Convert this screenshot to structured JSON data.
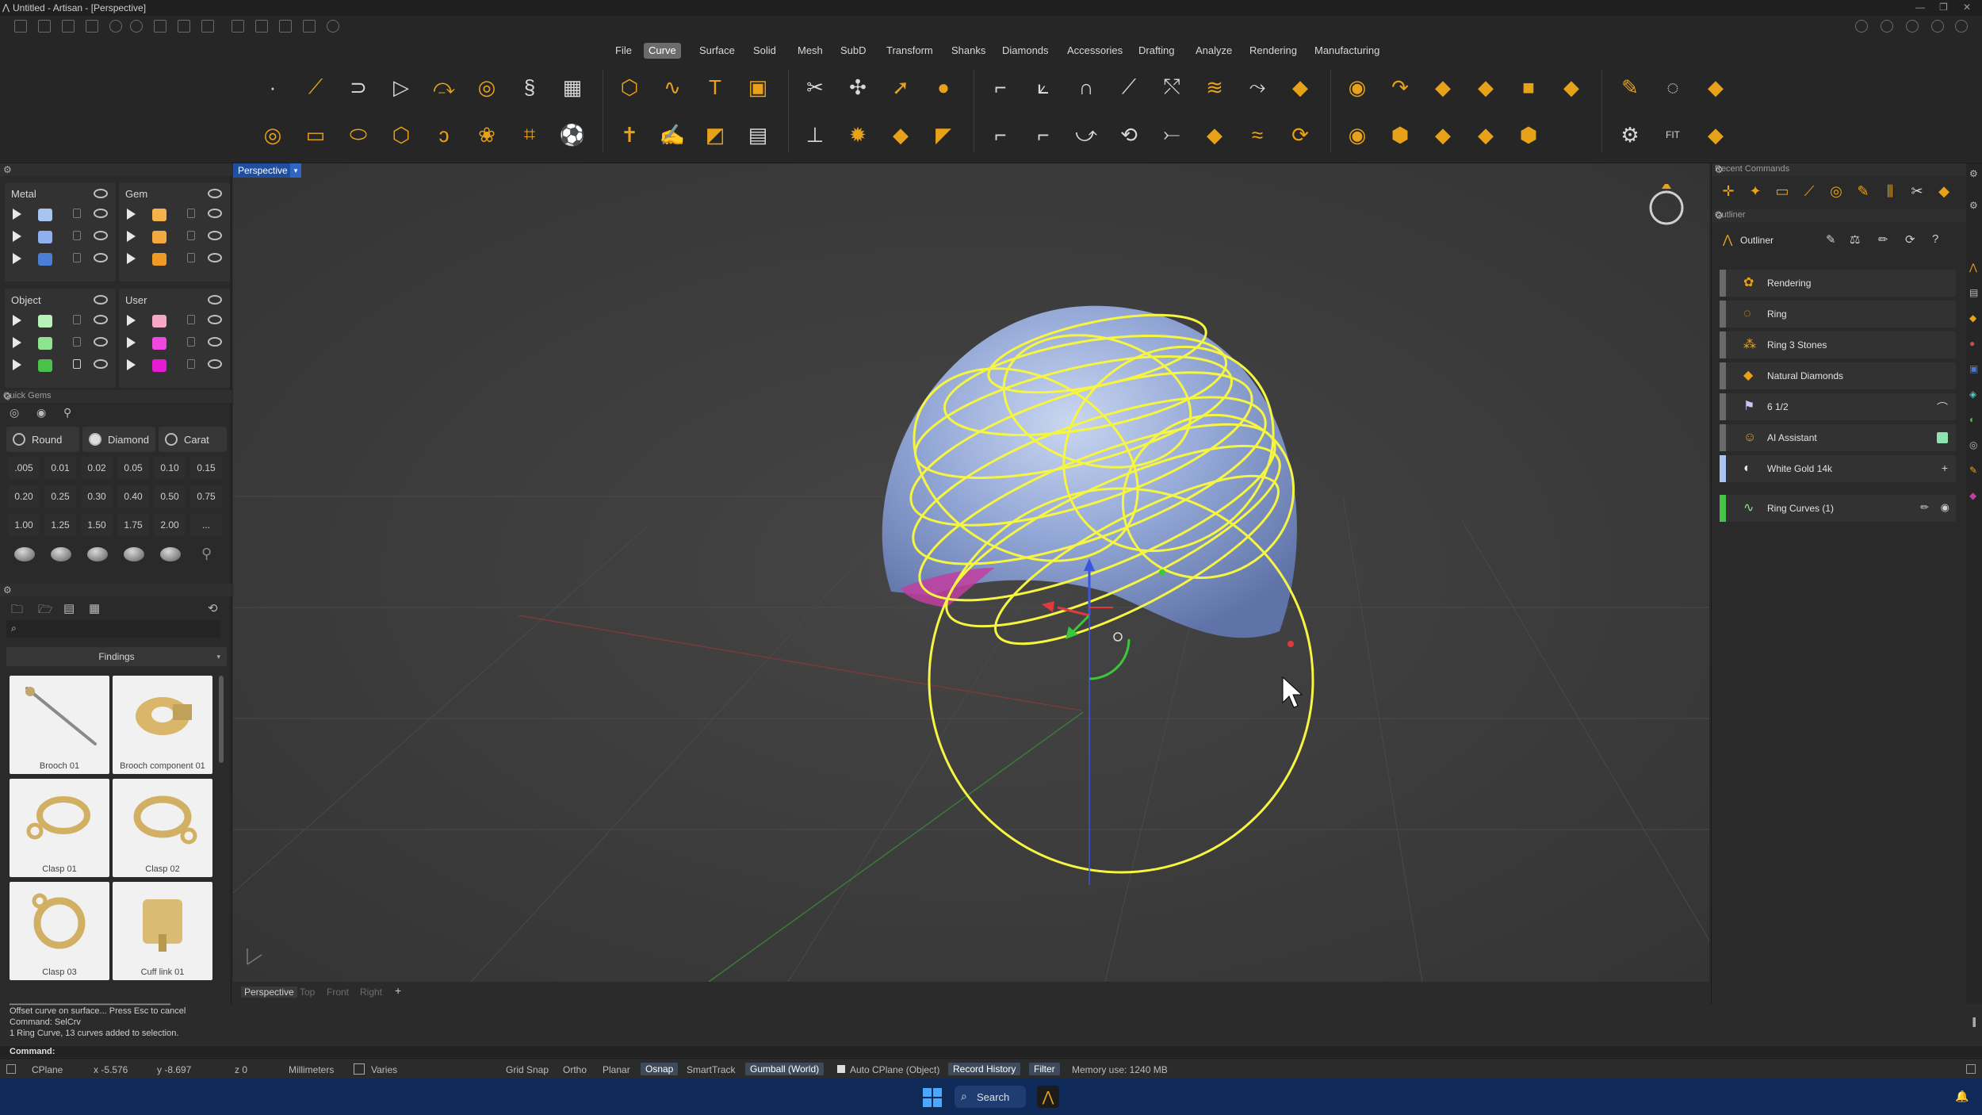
{
  "window": {
    "title": "Untitled - Artisan - [Perspective]",
    "controls": [
      "—",
      "❐",
      "✕"
    ]
  },
  "menu": {
    "items": [
      "File",
      "Curve",
      "Surface",
      "Solid",
      "Mesh",
      "SubD",
      "Transform",
      "Shanks",
      "Diamonds",
      "Accessories",
      "Drafting",
      "Analyze",
      "Rendering",
      "Manufacturing"
    ],
    "active": "Curve"
  },
  "layers": {
    "metal": {
      "title": "Metal",
      "colors": [
        "#a8c4f2",
        "#8fb0ee",
        "#4b7fd6"
      ]
    },
    "gem": {
      "title": "Gem",
      "colors": [
        "#f5b24a",
        "#f3a93d",
        "#ef9a25"
      ]
    },
    "object": {
      "title": "Object",
      "colors": [
        "#b9f2b9",
        "#8ee38e",
        "#48c248"
      ]
    },
    "user": {
      "title": "User",
      "colors": [
        "#f7a6c6",
        "#ee48e0",
        "#e61ad2"
      ]
    }
  },
  "quick_gems": {
    "title": "Quick Gems",
    "shape": "Round",
    "cut": "Diamond",
    "unit": "Carat",
    "sizes": [
      ".005",
      "0.01",
      "0.02",
      "0.05",
      "0.10",
      "0.15",
      "0.20",
      "0.25",
      "0.30",
      "0.40",
      "0.50",
      "0.75",
      "1.00",
      "1.25",
      "1.50",
      "1.75",
      "2.00",
      "..."
    ]
  },
  "library": {
    "search_placeholder": "",
    "category": "Findings",
    "items": [
      "Brooch 01",
      "Brooch component 01",
      "Clasp 01",
      "Clasp 02",
      "Clasp 03",
      "Cuff link 01"
    ]
  },
  "viewport": {
    "active": "Perspective",
    "tabs": [
      "Perspective",
      "Top",
      "Front",
      "Right"
    ],
    "add": "+"
  },
  "right": {
    "recent_title": "Recent Commands",
    "outliner_title": "Outliner",
    "outliner_header": "Outliner",
    "items": [
      {
        "label": "Rendering",
        "icon": "palette-icon",
        "right": ""
      },
      {
        "label": "Ring",
        "icon": "ring-icon",
        "right": ""
      },
      {
        "label": "Ring 3 Stones",
        "icon": "stones-icon",
        "right": ""
      },
      {
        "label": "Natural Diamonds",
        "icon": "diamond-icon",
        "right": ""
      },
      {
        "label": "6 1/2",
        "icon": "flag-icon",
        "right": ""
      },
      {
        "label": "AI Assistant",
        "icon": "assistant-icon",
        "right": ""
      },
      {
        "label": "White Gold 14k",
        "icon": "material-icon",
        "right": "+"
      }
    ],
    "curves_item": {
      "label": "Ring Curves (1)",
      "bar_color": "#48c248"
    }
  },
  "command": {
    "history": [
      "Offset curve on surface... Press Esc to cancel",
      "Command: SelCrv",
      "1 Ring Curve, 13 curves added to selection."
    ],
    "prompt": "Command:"
  },
  "status": {
    "cplane": "CPlane",
    "x": "x -5.576",
    "y": "y -8.697",
    "z": "z 0",
    "units": "Millimeters",
    "layer": "Varies",
    "grid_snap": "Grid Snap",
    "ortho": "Ortho",
    "planar": "Planar",
    "osnap": "Osnap",
    "smarttrack": "SmartTrack",
    "gumball": "Gumball (World)",
    "auto_cplane": "Auto CPlane (Object)",
    "record_history": "Record History",
    "filter": "Filter",
    "memory": "Memory use: 1240 MB"
  },
  "taskbar": {
    "search": "Search"
  },
  "colors": {
    "accent": "#1f4f9e",
    "curve": "#f5f542",
    "toolbar_icon": "#e8a21a"
  }
}
